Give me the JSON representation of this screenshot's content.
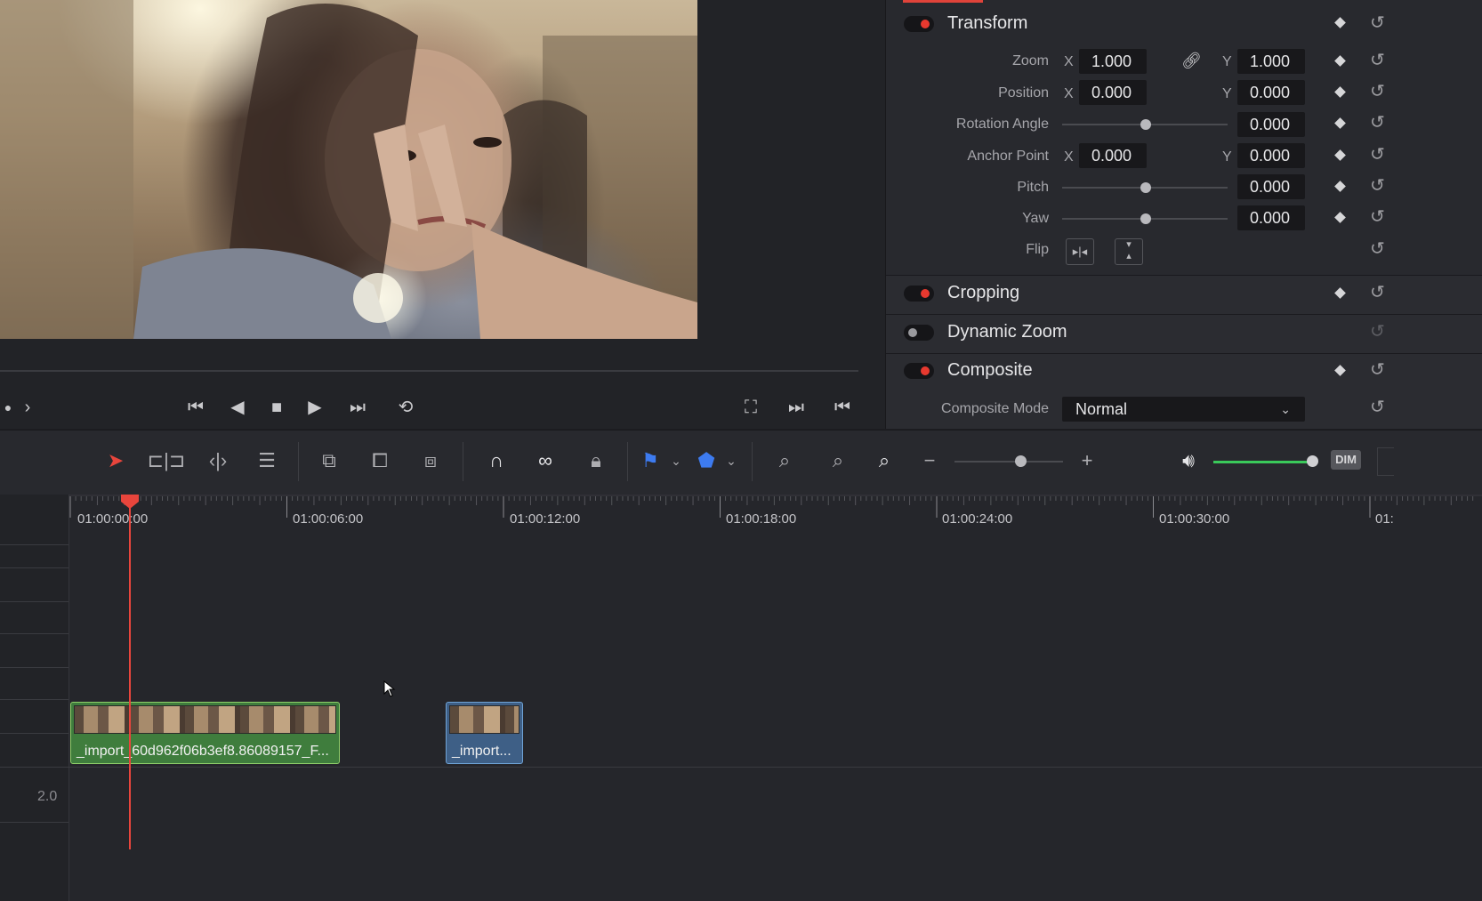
{
  "viewer": {
    "playback_controls": [
      "⏮",
      "◀",
      "■",
      "▶",
      "⏭",
      "⟲"
    ],
    "right_controls": [
      "⛶",
      "⏭",
      "⏮"
    ],
    "left_nav": [
      "●",
      "›"
    ]
  },
  "inspector": {
    "transform": {
      "title": "Transform",
      "enabled": true,
      "zoom": {
        "label": "Zoom",
        "x": "1.000",
        "y": "1.000"
      },
      "position": {
        "label": "Position",
        "x": "0.000",
        "y": "0.000"
      },
      "rotation": {
        "label": "Rotation Angle",
        "value": "0.000"
      },
      "anchor": {
        "label": "Anchor Point",
        "x": "0.000",
        "y": "0.000"
      },
      "pitch": {
        "label": "Pitch",
        "value": "0.000"
      },
      "yaw": {
        "label": "Yaw",
        "value": "0.000"
      },
      "flip": {
        "label": "Flip"
      },
      "axis_x": "X",
      "axis_y": "Y"
    },
    "cropping": {
      "title": "Cropping",
      "enabled": true
    },
    "dynamic_zoom": {
      "title": "Dynamic Zoom",
      "enabled": false
    },
    "composite": {
      "title": "Composite",
      "enabled": true,
      "mode_label": "Composite Mode",
      "mode_value": "Normal"
    }
  },
  "toolbar": {
    "dim_label": "DIM",
    "zoom_minus": "−",
    "zoom_plus": "+"
  },
  "timeline": {
    "timecodes": [
      "01:00:00:00",
      "01:00:06:00",
      "01:00:12:00",
      "01:00:18:00",
      "01:00:24:00",
      "01:00:30:00",
      "01:"
    ],
    "clips": [
      {
        "name": "_import_60d962f06b3ef8.86089157_F..."
      },
      {
        "name": "_import..."
      }
    ],
    "audio_track_label": "2.0"
  },
  "colors": {
    "accent_red": "#e8392f",
    "clip_green": "#3f7d3d",
    "clip_blue": "#3e5f86"
  }
}
